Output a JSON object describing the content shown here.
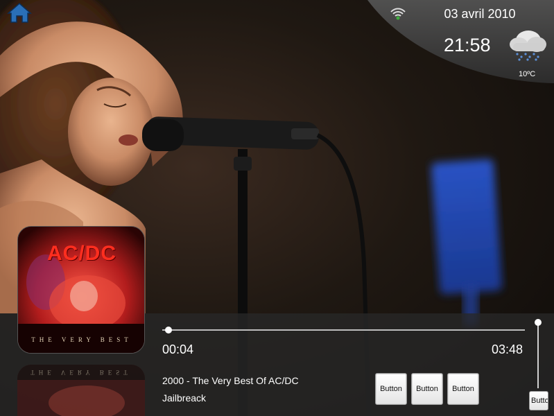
{
  "status": {
    "date": "03 avril 2010",
    "time": "21:58",
    "temperature": "10ºC",
    "weather_icon": "rain-cloud-icon",
    "wifi_icon": "wifi-icon",
    "wifi_color": "#3fae3f"
  },
  "nav": {
    "home_icon": "home-icon",
    "home_color": "#2a6fb7"
  },
  "album_art": {
    "band": "AC/DC",
    "subtitle": "THE VERY BEST",
    "reflection_subtitle": "THE VERY BEST"
  },
  "player": {
    "elapsed": "00:04",
    "total": "03:48",
    "progress_fraction": 0.018,
    "volume_fraction": 1.0,
    "album_line": "2000 - The Very Best Of AC/DC",
    "track_line": "Jailbreack",
    "buttons": [
      "Button",
      "Button",
      "Button"
    ],
    "volume_button_label": "Button"
  },
  "colors": {
    "bar_background": "#282828",
    "status_panel": "#3a3a3a",
    "button_face": "#f2f2f2"
  }
}
